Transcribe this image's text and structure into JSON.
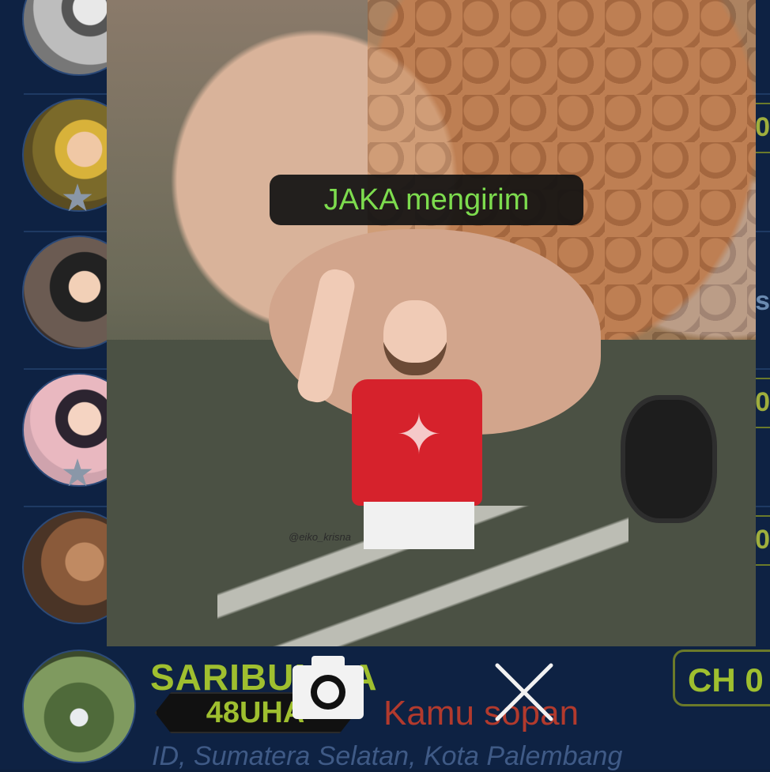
{
  "notice": {
    "text": "JAKA mengirim"
  },
  "bottom_user": {
    "name": "SARIBUNGA",
    "level": "48UHA",
    "status": "Kamu sopan",
    "location": "ID, Sumatera Selatan, Kota Palembang",
    "channel_chip": "CH 0"
  },
  "side_chips": [
    "0",
    "s",
    "0",
    "0"
  ],
  "watermark": "@eiko_krisna",
  "colors": {
    "accent_green": "#9fbf2f",
    "notice_green": "#7ddc4e",
    "status_red": "#b23a2d",
    "background": "#0e2243"
  },
  "icons": {
    "camera": "camera-icon",
    "close": "close-icon",
    "star": "star-icon"
  }
}
